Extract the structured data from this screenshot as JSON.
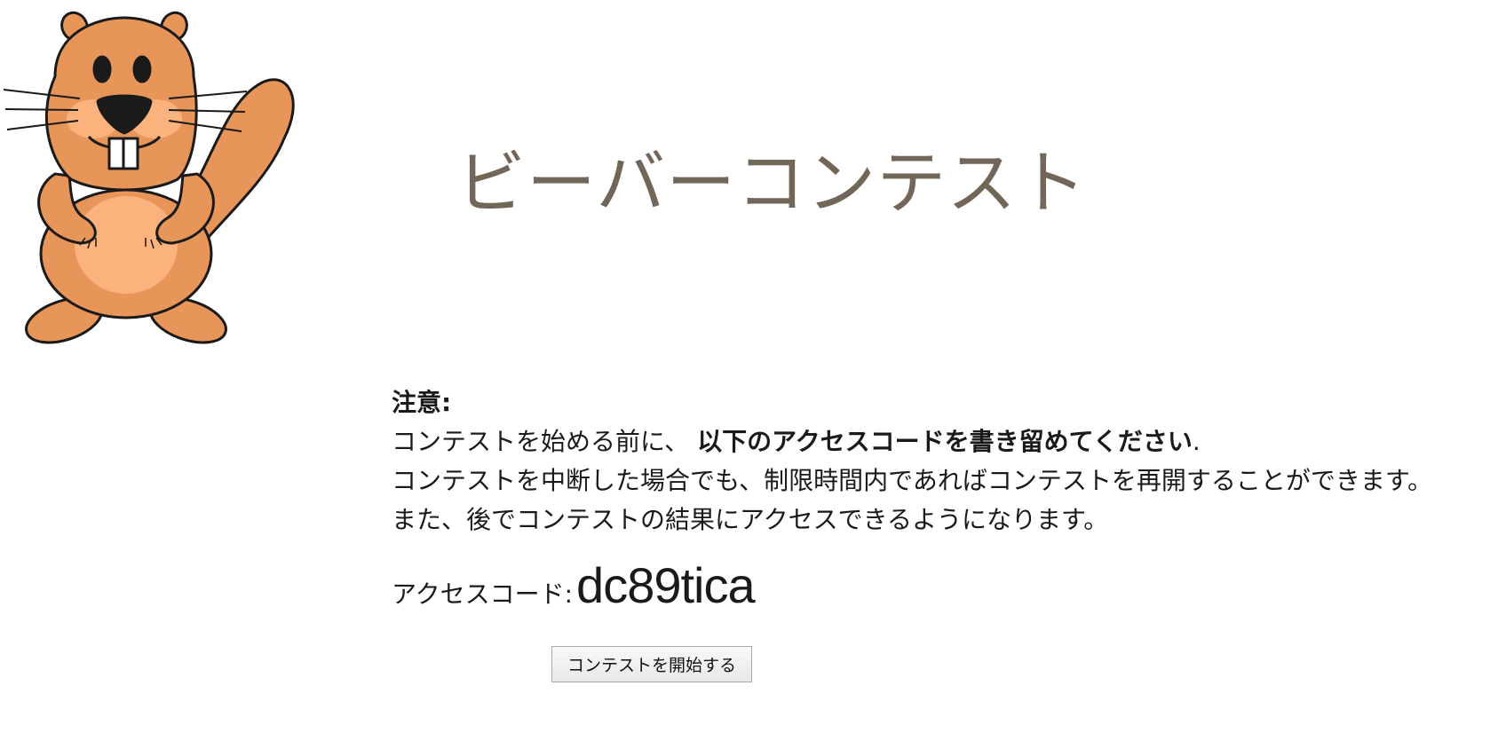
{
  "header": {
    "title": "ビーバーコンテスト",
    "title_color": "#726658",
    "logo_icon": "beaver-mascot-icon"
  },
  "notice": {
    "heading": "注意:",
    "line1_prefix": "コンテストを始める前に、",
    "line1_bold": "以下のアクセスコードを書き留めてください",
    "line1_suffix": ".",
    "line2": "コンテストを中断した場合でも、制限時間内であればコンテストを再開することができます。",
    "line3": "また、後でコンテストの結果にアクセスできるようになります。"
  },
  "access": {
    "label": "アクセスコード:",
    "code": "dc89tica"
  },
  "actions": {
    "start_label": "コンテストを開始する"
  },
  "colors": {
    "beaver_body": "#e8955a",
    "beaver_belly": "#fbb27c",
    "outline": "#1a1a1a"
  }
}
